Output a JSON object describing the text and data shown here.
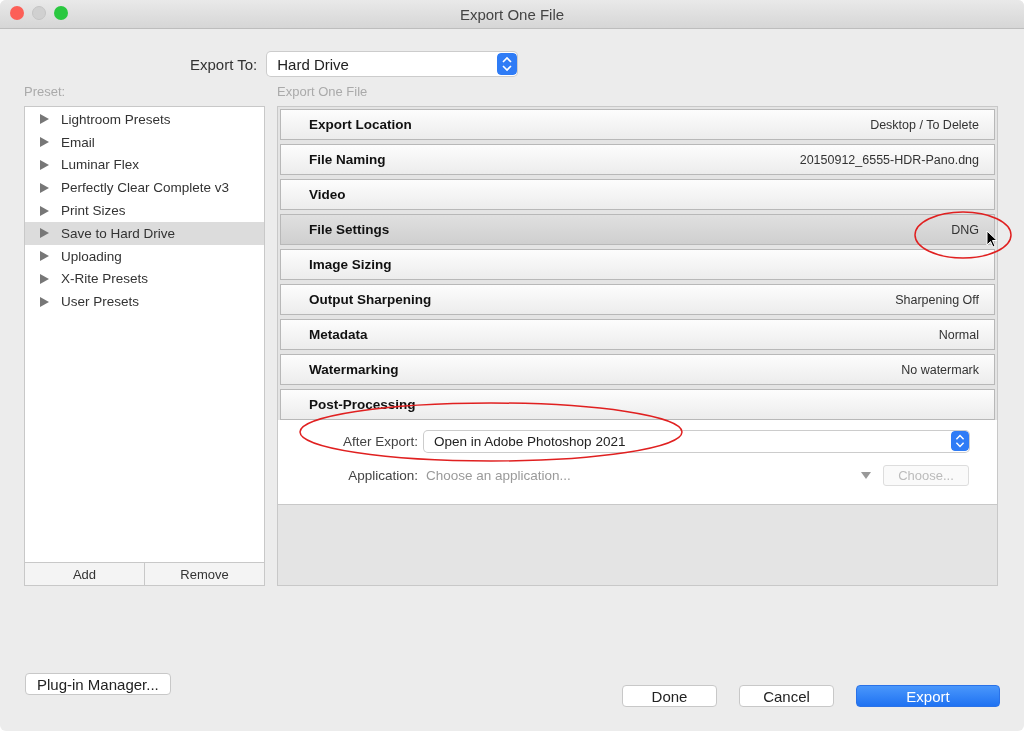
{
  "window": {
    "title": "Export One File"
  },
  "export_to": {
    "label": "Export To:",
    "value": "Hard Drive"
  },
  "preset": {
    "label": "Preset:",
    "items": [
      {
        "label": "Lightroom Presets",
        "selected": false
      },
      {
        "label": "Email",
        "selected": false
      },
      {
        "label": "Luminar Flex",
        "selected": false
      },
      {
        "label": "Perfectly Clear Complete v3",
        "selected": false
      },
      {
        "label": "Print Sizes",
        "selected": false
      },
      {
        "label": "Save to Hard Drive",
        "selected": true
      },
      {
        "label": "Uploading",
        "selected": false
      },
      {
        "label": "X-Rite Presets",
        "selected": false
      },
      {
        "label": "User Presets",
        "selected": false
      }
    ],
    "buttons": [
      "Add",
      "Remove"
    ]
  },
  "settings": {
    "label": "Export One File",
    "sections": [
      {
        "title": "Export Location",
        "summary": "Desktop / To Delete",
        "selected": false,
        "expanded": false
      },
      {
        "title": "File Naming",
        "summary": "20150912_6555-HDR-Pano.dng",
        "selected": false,
        "expanded": false
      },
      {
        "title": "Video",
        "selected": false,
        "expanded": false
      },
      {
        "title": "File Settings",
        "summary": "DNG",
        "selected": true,
        "expanded": false
      },
      {
        "title": "Image Sizing",
        "selected": false,
        "expanded": false
      },
      {
        "title": "Output Sharpening",
        "summary": "Sharpening Off",
        "selected": false,
        "expanded": false
      },
      {
        "title": "Metadata",
        "summary": "Normal",
        "selected": false,
        "expanded": false
      },
      {
        "title": "Watermarking",
        "summary": "No watermark",
        "selected": false,
        "expanded": false
      },
      {
        "title": "Post-Processing",
        "selected": false,
        "expanded": true
      }
    ],
    "post_processing": {
      "after_export_label": "After Export:",
      "after_export_value": "Open in Adobe Photoshop 2021",
      "application_label": "Application:",
      "application_placeholder": "Choose an application...",
      "choose_button": "Choose...",
      "choose_disabled": true
    }
  },
  "plugin_manager": "Plug-in Manager...",
  "buttons": [
    {
      "label": "Done",
      "primary": false
    },
    {
      "label": "Cancel",
      "primary": false
    },
    {
      "label": "Export",
      "primary": true
    }
  ]
}
